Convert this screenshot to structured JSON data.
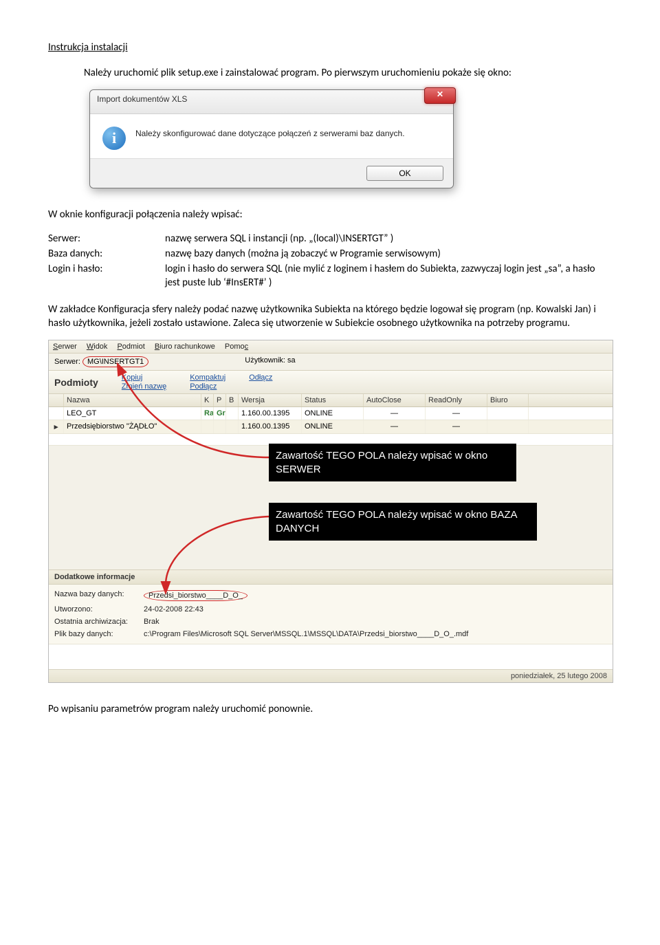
{
  "doc": {
    "heading": "Instrukcja instalacji",
    "intro": "Należy uruchomić plik setup.exe i zainstalować program. Po pierwszym uruchomieniu pokaże się okno:",
    "after_dialog": "W oknie konfiguracji połączenia należy wpisać:",
    "defs": {
      "serwer_label": "Serwer:",
      "serwer_value": "nazwę serwera SQL i instancji (np. „(local)\\INSERTGT” )",
      "baza_label": "Baza danych:",
      "baza_value": "nazwę bazy danych (można ją zobaczyć w Programie serwisowym)",
      "login_label": "Login i hasło:",
      "login_value": "login i hasło do serwera SQL (nie mylić z loginem i hasłem do Subiekta, zazwyczaj login jest „sa”, a hasło jest puste lub ‘#InsERT#’ )"
    },
    "para2": "W zakładce Konfiguracja sfery należy podać nazwę użytkownika Subiekta na którego będzie logował się program (np. Kowalski Jan) i hasło użytkownika, jeżeli zostało ustawione. Zaleca się utworzenie w Subiekcie osobnego użytkownika na potrzeby programu.",
    "closing": "Po wpisaniu parametrów program należy uruchomić ponownie."
  },
  "dialog": {
    "title": "Import dokumentów XLS",
    "message": "Należy skonfigurować dane dotyczące połączeń z serwerami baz danych.",
    "ok": "OK",
    "close_glyph": "✕",
    "info_glyph": "i"
  },
  "app": {
    "menu": {
      "serwer": "Serwer",
      "widok": "Widok",
      "podmiot": "Podmiot",
      "biuro": "Biuro rachunkowe",
      "pomoc": "Pomoc"
    },
    "infobar": {
      "serwer_label": "Serwer:",
      "serwer_value": "MG\\INSERTGT1",
      "user_label": "Użytkownik:",
      "user_value": "sa"
    },
    "podmioty": {
      "title": "Podmioty",
      "links": {
        "kopiuj": "Kopiuj",
        "zmien": "Zmień nazwę",
        "kompaktuj": "Kompaktuj",
        "podlacz": "Podłącz",
        "odlacz": "Odłącz"
      }
    },
    "grid": {
      "headers": {
        "nazwa": "Nazwa",
        "k": "K",
        "p": "P",
        "b": "B",
        "wersja": "Wersja",
        "status": "Status",
        "autoclose": "AutoClose",
        "readonly": "ReadOnly",
        "biuro": "Biuro"
      },
      "rows": [
        {
          "mark": "",
          "nazwa": "LEO_GT",
          "k": "Ra",
          "p": "Gr",
          "b": "",
          "wersja": "1.160.00.1395",
          "status": "ONLINE",
          "autoclose": "—",
          "readonly": "—",
          "biuro": ""
        },
        {
          "mark": "▸",
          "nazwa": "Przedsiębiorstwo \"ŻĄDŁO\"",
          "k": "",
          "p": "",
          "b": "",
          "wersja": "1.160.00.1395",
          "status": "ONLINE",
          "autoclose": "—",
          "readonly": "—",
          "biuro": ""
        }
      ]
    },
    "annot1": "Zawartość TEGO POLA należy wpisać w okno SERWER",
    "annot2": "Zawartość TEGO POLA należy wpisać w okno BAZA DANYCH",
    "dod_info": "Dodatkowe informacje",
    "details": {
      "nazwa_label": "Nazwa bazy danych:",
      "nazwa_value": "Przedsi_biorstwo____D_O_",
      "utw_label": "Utworzono:",
      "utw_value": "24-02-2008 22:43",
      "arch_label": "Ostatnia archiwizacja:",
      "arch_value": "Brak",
      "plik_label": "Plik bazy danych:",
      "plik_value": "c:\\Program Files\\Microsoft SQL Server\\MSSQL.1\\MSSQL\\DATA\\Przedsi_biorstwo____D_O_.mdf"
    },
    "statusbar": "poniedziałek, 25 lutego 2008"
  }
}
